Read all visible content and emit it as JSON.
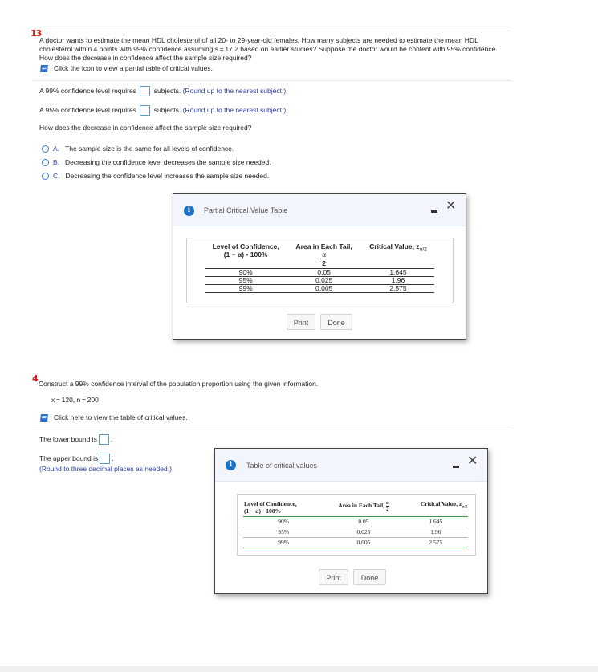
{
  "q13": {
    "number": "13",
    "prompt_lines": [
      "A doctor wants to estimate the mean HDL cholesterol of all 20- to 29-year-old females. How many subjects are needed to estimate the mean HDL",
      "cholesterol within 4 points with 99% confidence assuming s = 17.2 based on earlier studies? Suppose the doctor would be content with 95% confidence.",
      "How does the decrease in confidence affect the sample size required?"
    ],
    "icon_link": "Click the icon to view a partial table of critical values.",
    "answer1_prefix": "A 99% confidence level requires",
    "answer1_suffix": "subjects.",
    "answer1_hint": "(Round up to the nearest subject.)",
    "answer1_value": "",
    "answer2_prefix": "A 95% confidence level requires",
    "answer2_suffix": "subjects.",
    "answer2_hint": "(Round up to the nearest subject.)",
    "answer2_value": "",
    "question": "How does the decrease in confidence affect the sample size required?",
    "options": [
      {
        "letter": "A.",
        "text": "The sample size is the same for all levels of confidence."
      },
      {
        "letter": "B.",
        "text": "Decreasing the confidence level decreases the sample size needed."
      },
      {
        "letter": "C.",
        "text": "Decreasing the confidence level increases the sample size needed."
      }
    ]
  },
  "dialog1": {
    "title": "Partial Critical Value Table",
    "headers": {
      "col1_line1": "Level of Confidence,",
      "col1_line2": "(1 − α) • 100%",
      "col2_line1": "Area in Each Tail,",
      "col2_num": "α",
      "col2_den": "2",
      "col3": "Critical Value, z",
      "col3_sub": "α/2"
    },
    "rows": [
      [
        "90%",
        "0.05",
        "1.645"
      ],
      [
        "95%",
        "0.025",
        "1.96"
      ],
      [
        "99%",
        "0.005",
        "2.575"
      ]
    ],
    "print_label": "Print",
    "done_label": "Done"
  },
  "q4": {
    "number": "4",
    "prompt": "Construct a 99% confidence interval of the population proportion using the given information.",
    "given": "x = 120, n = 200",
    "icon_link": "Click here to view the table of critical values.",
    "lower_prefix": "The lower bound is",
    "lower_value": "",
    "upper_prefix": "The upper bound is",
    "upper_value": "",
    "hint": "(Round to three decimal places as needed.)"
  },
  "dialog2": {
    "title": "Table of critical values",
    "headers": {
      "col1_line1": "Level of Confidence,",
      "col1_line2": "(1 − α) · 100%",
      "col2": "Area in Each Tail,",
      "col2_num": "α",
      "col2_den": "2",
      "col3": "Critical Value, z",
      "col3_sub": "α/2"
    },
    "rows": [
      [
        "90%",
        "0.05",
        "1.645"
      ],
      [
        "95%",
        "0.025",
        "1.96"
      ],
      [
        "99%",
        "0.005",
        "2.575"
      ]
    ],
    "print_label": "Print",
    "done_label": "Done"
  }
}
